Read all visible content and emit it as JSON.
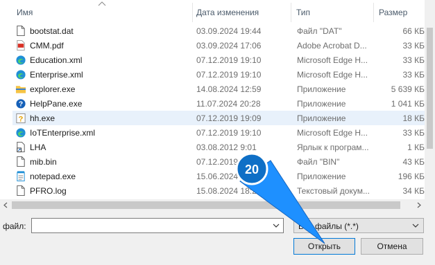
{
  "columns": {
    "name": "Имя",
    "date": "Дата изменения",
    "type": "Тип",
    "size": "Размер"
  },
  "rows": [
    {
      "icon": "document-file-icon",
      "name": "bootstat.dat",
      "date": "03.09.2024 19:44",
      "type": "Файл \"DAT\"",
      "size": "66 КБ"
    },
    {
      "icon": "pdf-file-icon",
      "name": "CMM.pdf",
      "date": "03.09.2024 17:06",
      "type": "Adobe Acrobat D...",
      "size": "33 КБ"
    },
    {
      "icon": "edge-icon",
      "name": "Education.xml",
      "date": "07.12.2019 19:10",
      "type": "Microsoft Edge H...",
      "size": "33 КБ"
    },
    {
      "icon": "edge-icon",
      "name": "Enterprise.xml",
      "date": "07.12.2019 19:10",
      "type": "Microsoft Edge H...",
      "size": "33 КБ"
    },
    {
      "icon": "explorer-folder-icon",
      "name": "explorer.exe",
      "date": "14.08.2024 12:59",
      "type": "Приложение",
      "size": "5 639 КБ"
    },
    {
      "icon": "help-icon",
      "name": "HelpPane.exe",
      "date": "11.07.2024 20:28",
      "type": "Приложение",
      "size": "1 041 КБ"
    },
    {
      "icon": "help-file-icon",
      "name": "hh.exe",
      "date": "07.12.2019 19:09",
      "type": "Приложение",
      "size": "18 КБ"
    },
    {
      "icon": "edge-icon",
      "name": "IoTEnterprise.xml",
      "date": "07.12.2019 19:10",
      "type": "Microsoft Edge H...",
      "size": "33 КБ"
    },
    {
      "icon": "shortcut-icon",
      "name": "LHA",
      "date": "03.08.2012 9:01",
      "type": "Ярлык к програм...",
      "size": "1 КБ"
    },
    {
      "icon": "document-file-icon",
      "name": "mib.bin",
      "date": "07.12.2019",
      "type": "Файл \"BIN\"",
      "size": "43 КБ"
    },
    {
      "icon": "notepad-icon",
      "name": "notepad.exe",
      "date": "15.06.2024",
      "type": "Приложение",
      "size": "196 КБ"
    },
    {
      "icon": "document-file-icon",
      "name": "PFRO.log",
      "date": "15.08.2024 18:20",
      "type": "Текстовый докум...",
      "size": "34 КБ"
    }
  ],
  "selected_index": 6,
  "file_label": "файл:",
  "file_name_value": "",
  "file_type_value": "Все файлы (*.*)",
  "open_label": "Открыть",
  "cancel_label": "Отмена",
  "annotation": {
    "step": "20",
    "color": "#1e90ff"
  }
}
